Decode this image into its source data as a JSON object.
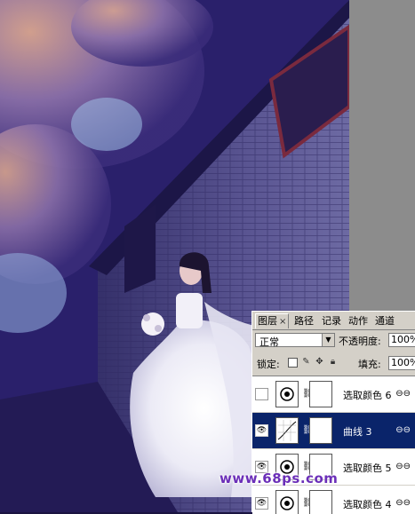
{
  "panel": {
    "tabs": [
      {
        "label": "图层",
        "active": true
      },
      {
        "label": "路径"
      },
      {
        "label": "记录"
      },
      {
        "label": "动作"
      },
      {
        "label": "通道"
      }
    ],
    "tab_close_glyph": "×",
    "blend_mode": "正常",
    "opacity_label": "不透明度:",
    "opacity_value": "100%",
    "lock_label": "锁定:",
    "fill_label": "填充:",
    "fill_value": "100%",
    "layers": [
      {
        "name": "选取颜色 6",
        "type": "selective-color",
        "visible": false,
        "selected": false
      },
      {
        "name": "曲线 3",
        "type": "curves",
        "visible": true,
        "selected": true
      },
      {
        "name": "选取颜色 5",
        "type": "selective-color",
        "visible": true,
        "selected": false
      },
      {
        "name": "选取颜色 4",
        "type": "selective-color",
        "visible": true,
        "selected": false
      }
    ]
  },
  "watermark": "www.68ps.com",
  "colors": {
    "sky": "#2b2170",
    "wall": "#4e4a86",
    "selected_layer": "#0a246a",
    "panel_bg": "#d4d0c8"
  }
}
